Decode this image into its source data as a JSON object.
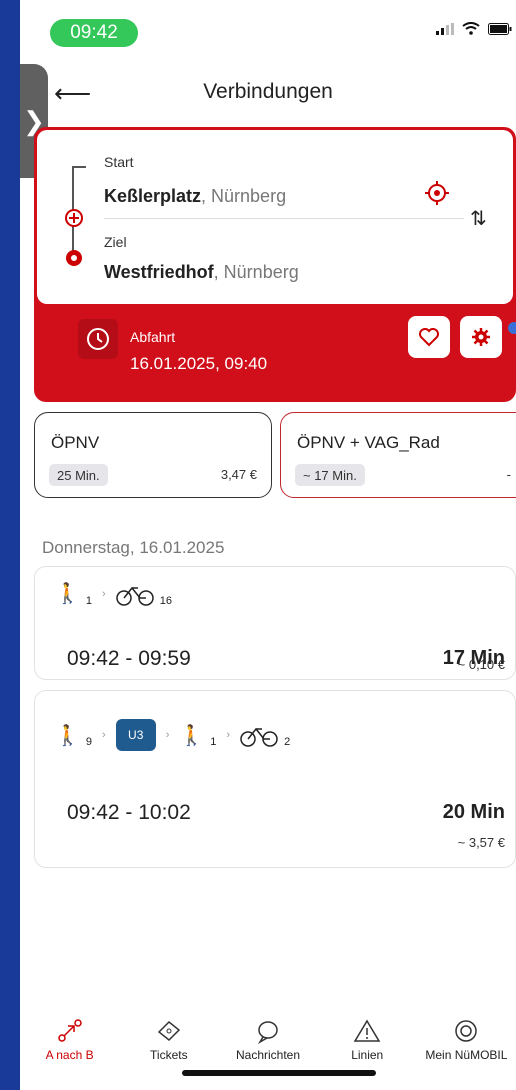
{
  "status": {
    "time": "09:42"
  },
  "header": {
    "title": "Verbindungen"
  },
  "route": {
    "start_label": "Start",
    "start_place": "Keßlerplatz",
    "start_city": ", Nürnberg",
    "dest_label": "Ziel",
    "dest_place": "Westfriedhof",
    "dest_city": ", Nürnberg",
    "departure_label": "Abfahrt",
    "departure_value": "16.01.2025, 09:40"
  },
  "modes": [
    {
      "title": "ÖPNV",
      "duration": "25 Min.",
      "price": "3,47 €"
    },
    {
      "title": "ÖPNV + VAG_Rad",
      "duration": "~ 17 Min.",
      "price": "-"
    }
  ],
  "day_header": "Donnerstag, 16.01.2025",
  "connections": [
    {
      "legs": [
        {
          "icon": "walk-icon",
          "sub": "1"
        },
        {
          "icon": "bike-icon",
          "sub": "16"
        }
      ],
      "time": "09:42 - 09:59",
      "duration": "17 Min",
      "price": "~ 0,10 €"
    },
    {
      "legs": [
        {
          "icon": "walk-icon",
          "sub": "9"
        },
        {
          "icon": "subway-badge",
          "sub": "U3"
        },
        {
          "icon": "walk-icon",
          "sub": "1"
        },
        {
          "icon": "bike-icon",
          "sub": "2"
        }
      ],
      "time": "09:42 - 10:02",
      "duration": "20 Min",
      "price": "~ 3,57 €"
    }
  ],
  "nav": [
    {
      "label": "A nach B",
      "icon": "route-icon",
      "active": true
    },
    {
      "label": "Tickets",
      "icon": "ticket-icon",
      "active": false
    },
    {
      "label": "Nachrichten",
      "icon": "chat-icon",
      "active": false
    },
    {
      "label": "Linien",
      "icon": "warning-icon",
      "active": false
    },
    {
      "label": "Mein NüMOBIL",
      "icon": "profile-icon",
      "active": false
    }
  ],
  "colors": {
    "brand_red": "#d10f1a",
    "status_green": "#34c759",
    "u3_blue": "#1f5b8f",
    "notification_blue": "#3a6fd8"
  }
}
